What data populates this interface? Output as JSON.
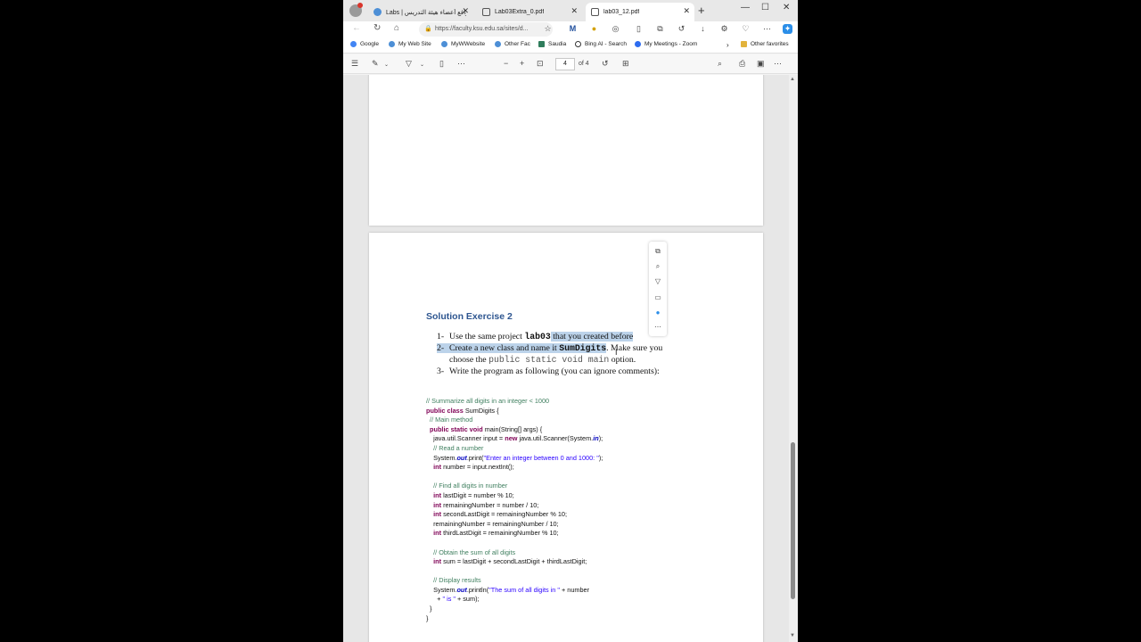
{
  "tabs": [
    {
      "title": "Labs | مواقع أعضاء هيئة التدريس",
      "active": false
    },
    {
      "title": "Lab03Extra_0.pdf",
      "active": false
    },
    {
      "title": "lab03_12.pdf",
      "active": true
    }
  ],
  "address": {
    "url": "https://faculty.ksu.edu.sa/sites/d..."
  },
  "favorites": [
    {
      "label": "Google"
    },
    {
      "label": "My Web Site"
    },
    {
      "label": "MyWWebsite"
    },
    {
      "label": "Other Fac"
    },
    {
      "label": "Saudia"
    },
    {
      "label": "Bing AI - Search"
    },
    {
      "label": "My Meetings - Zoom"
    },
    {
      "label": "Other favorites"
    }
  ],
  "pdf_toolbar": {
    "page_current": "4",
    "page_total": "of 4"
  },
  "document": {
    "heading": "Solution Exercise 2",
    "steps": [
      {
        "num": "1-",
        "pre": "Use the same project ",
        "code": "lab03",
        "post": " that you created before"
      },
      {
        "num": "2-",
        "pre": "Create a new class and name it ",
        "code": "SumDigits",
        "post": ". Make sure you"
      },
      {
        "num": "",
        "pre": "choose the ",
        "code": "public static void main",
        "post": " option."
      },
      {
        "num": "3-",
        "pre": "Write the program as following (you can ignore comments):",
        "code": "",
        "post": ""
      }
    ],
    "code_lines": [
      [
        {
          "t": "// Summarize all digits in an integer < 1000",
          "c": "cm"
        }
      ],
      [
        {
          "t": "public class ",
          "c": "kw"
        },
        {
          "t": "SumDigits {",
          "c": ""
        }
      ],
      [
        {
          "t": "  // Main method",
          "c": "cm"
        }
      ],
      [
        {
          "t": "  public static void ",
          "c": "kw"
        },
        {
          "t": "main(String[] args) {",
          "c": ""
        }
      ],
      [
        {
          "t": "    java.util.Scanner input = ",
          "c": ""
        },
        {
          "t": "new ",
          "c": "kw"
        },
        {
          "t": "java.util.Scanner(System.",
          "c": ""
        },
        {
          "t": "in",
          "c": "fi"
        },
        {
          "t": ");",
          "c": ""
        }
      ],
      [
        {
          "t": "    // Read a number",
          "c": "cm"
        }
      ],
      [
        {
          "t": "    System.",
          "c": ""
        },
        {
          "t": "out",
          "c": "fi"
        },
        {
          "t": ".print(",
          "c": ""
        },
        {
          "t": "\"Enter an integer between 0 and 1000: \"",
          "c": "st"
        },
        {
          "t": ");",
          "c": ""
        }
      ],
      [
        {
          "t": "    int ",
          "c": "kw"
        },
        {
          "t": "number = input.nextInt();",
          "c": ""
        }
      ],
      [
        {
          "t": "",
          "c": ""
        }
      ],
      [
        {
          "t": "    // Find all digits in number",
          "c": "cm"
        }
      ],
      [
        {
          "t": "    int ",
          "c": "kw"
        },
        {
          "t": "lastDigit = number % 10;",
          "c": ""
        }
      ],
      [
        {
          "t": "    int ",
          "c": "kw"
        },
        {
          "t": "remainingNumber = number / 10;",
          "c": ""
        }
      ],
      [
        {
          "t": "    int ",
          "c": "kw"
        },
        {
          "t": "secondLastDigit = remainingNumber % 10;",
          "c": ""
        }
      ],
      [
        {
          "t": "    remainingNumber = remainingNumber / 10;",
          "c": ""
        }
      ],
      [
        {
          "t": "    int ",
          "c": "kw"
        },
        {
          "t": "thirdLastDigit = remainingNumber % 10;",
          "c": ""
        }
      ],
      [
        {
          "t": "",
          "c": ""
        }
      ],
      [
        {
          "t": "    // Obtain the sum of all digits",
          "c": "cm"
        }
      ],
      [
        {
          "t": "    int ",
          "c": "kw"
        },
        {
          "t": "sum = lastDigit + secondLastDigit + thirdLastDigit;",
          "c": ""
        }
      ],
      [
        {
          "t": "",
          "c": ""
        }
      ],
      [
        {
          "t": "    // Display results",
          "c": "cm"
        }
      ],
      [
        {
          "t": "    System.",
          "c": ""
        },
        {
          "t": "out",
          "c": "fi"
        },
        {
          "t": ".println(",
          "c": ""
        },
        {
          "t": "\"The sum of all digits in \"",
          "c": "st"
        },
        {
          "t": " + number",
          "c": ""
        }
      ],
      [
        {
          "t": "      + ",
          "c": ""
        },
        {
          "t": "\" is \"",
          "c": "st"
        },
        {
          "t": " + sum);",
          "c": ""
        }
      ],
      [
        {
          "t": "  }",
          "c": ""
        }
      ],
      [
        {
          "t": "}",
          "c": ""
        }
      ]
    ]
  },
  "icons": [
    "back-icon",
    "refresh-icon",
    "home-icon",
    "lock-icon",
    "favorite-star-icon",
    "split-screen-icon",
    "collections-icon",
    "history-icon",
    "download-icon",
    "extensions-icon",
    "copilot-icon",
    "contents-icon",
    "draw-icon",
    "highlight-icon",
    "read-aloud-icon",
    "zoom-out-icon",
    "zoom-in-icon",
    "fit-page-icon",
    "rotate-icon",
    "page-view-icon",
    "find-icon",
    "print-icon",
    "save-icon",
    "more-icon"
  ],
  "colors": {
    "heading": "#2e5690",
    "highlight": "#bcd3ea",
    "keyword": "#7f0055",
    "comment": "#3f7f5f",
    "string": "#2a00ff"
  }
}
